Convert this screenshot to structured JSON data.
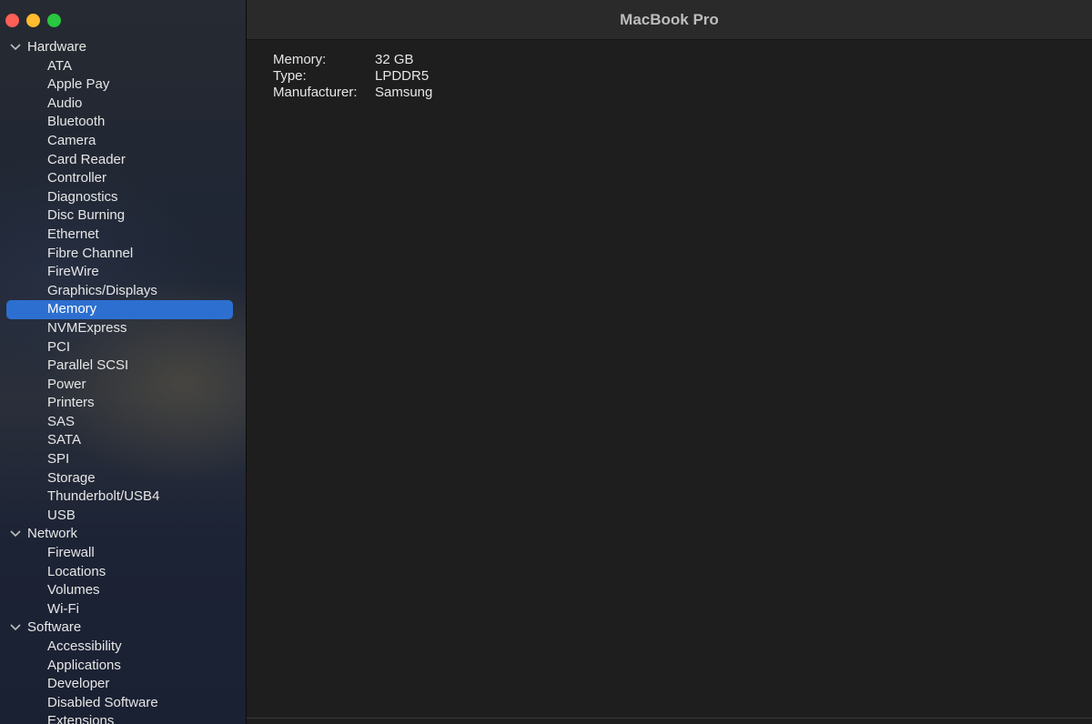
{
  "window": {
    "title": "MacBook Pro"
  },
  "sidebar": {
    "groups": [
      {
        "label": "Hardware",
        "items": [
          "ATA",
          "Apple Pay",
          "Audio",
          "Bluetooth",
          "Camera",
          "Card Reader",
          "Controller",
          "Diagnostics",
          "Disc Burning",
          "Ethernet",
          "Fibre Channel",
          "FireWire",
          "Graphics/Displays",
          "Memory",
          "NVMExpress",
          "PCI",
          "Parallel SCSI",
          "Power",
          "Printers",
          "SAS",
          "SATA",
          "SPI",
          "Storage",
          "Thunderbolt/USB4",
          "USB"
        ]
      },
      {
        "label": "Network",
        "items": [
          "Firewall",
          "Locations",
          "Volumes",
          "Wi-Fi"
        ]
      },
      {
        "label": "Software",
        "items": [
          "Accessibility",
          "Applications",
          "Developer",
          "Disabled Software",
          "Extensions"
        ]
      }
    ],
    "selected": "Memory"
  },
  "details": [
    {
      "key": "Memory:",
      "value": "32 GB"
    },
    {
      "key": "Type:",
      "value": "LPDDR5"
    },
    {
      "key": "Manufacturer:",
      "value": "Samsung"
    }
  ],
  "colors": {
    "selection": "#2d6fd0",
    "close": "#fe5f57",
    "minimize": "#febc2e",
    "zoom": "#28c840"
  }
}
